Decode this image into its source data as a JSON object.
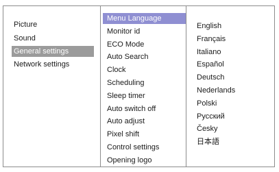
{
  "menu": {
    "main_items": [
      {
        "label": "Picture",
        "selected": false
      },
      {
        "label": "Sound",
        "selected": false
      },
      {
        "label": "General settings",
        "selected": true
      },
      {
        "label": "Network settings",
        "selected": false
      }
    ],
    "sub_items": [
      {
        "label": "Menu Language",
        "selected": true
      },
      {
        "label": "Monitor id",
        "selected": false
      },
      {
        "label": "ECO Mode",
        "selected": false
      },
      {
        "label": "Auto Search",
        "selected": false
      },
      {
        "label": "Clock",
        "selected": false
      },
      {
        "label": "Scheduling",
        "selected": false
      },
      {
        "label": "Sleep timer",
        "selected": false
      },
      {
        "label": "Auto switch off",
        "selected": false
      },
      {
        "label": "Auto adjust",
        "selected": false
      },
      {
        "label": "Pixel shift",
        "selected": false
      },
      {
        "label": "Control settings",
        "selected": false
      },
      {
        "label": "Opening  logo",
        "selected": false
      }
    ],
    "options": [
      "English",
      "Français",
      "Italiano",
      "Español",
      "Deutsch",
      "Nederlands",
      "Polski",
      "Русский",
      "Česky",
      "日本語"
    ]
  },
  "colors": {
    "main_selection": "#9b9b9b",
    "sub_selection": "#8f8fd2",
    "border": "#8c8c8c"
  }
}
